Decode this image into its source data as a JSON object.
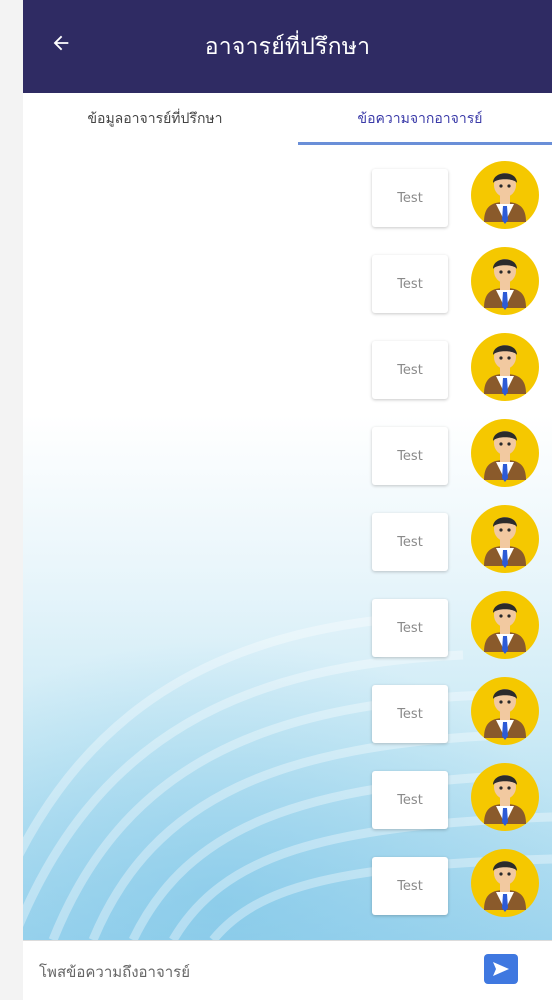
{
  "header": {
    "title": "อาจารย์ที่ปรึกษา"
  },
  "tabs": [
    {
      "label": "ข้อมูลอาจารย์ที่ปรึกษา",
      "active": false
    },
    {
      "label": "ข้อความจากอาจารย์",
      "active": true
    }
  ],
  "messages": [
    {
      "text": "Test"
    },
    {
      "text": "Test"
    },
    {
      "text": "Test"
    },
    {
      "text": "Test"
    },
    {
      "text": "Test"
    },
    {
      "text": "Test"
    },
    {
      "text": "Test"
    },
    {
      "text": "Test"
    },
    {
      "text": "Test"
    }
  ],
  "composer": {
    "placeholder": "โพสข้อความถึงอาจารย์",
    "value": ""
  },
  "colors": {
    "appbar": "#2f2b63",
    "send": "#3f78e0",
    "tab_active": "#3a3aa8",
    "indicator": "#6a8fd8",
    "avatar_bg": "#f5c800"
  },
  "icons": {
    "back": "arrow-left-icon",
    "avatar": "teacher-avatar-icon",
    "send": "send-arrow-icon"
  }
}
